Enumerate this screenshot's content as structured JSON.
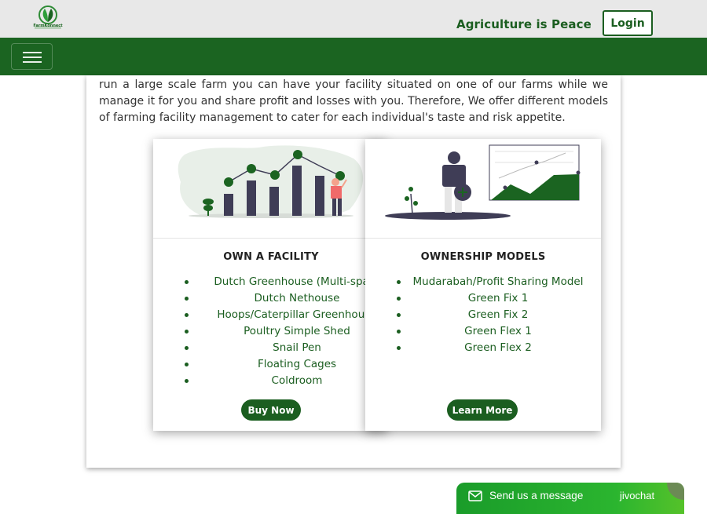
{
  "header": {
    "logo_text": "FarmKonnect",
    "tagline": "Agriculture is Peace",
    "login_label": "Login"
  },
  "intro": {
    "text": "run a large scale farm you can have your facility situated on one of our farms while we manage it for you and share profit and losses with you. Therefore, We offer different models of farming facility management to cater for each individual's taste and risk appetite."
  },
  "cards": [
    {
      "title": "OWN A FACILITY",
      "items": [
        "Dutch Greenhouse (Multi-span)",
        "Dutch Nethouse",
        "Hoops/Caterpillar Greenhouse",
        "Poultry Simple Shed",
        "Snail Pen",
        "Floating Cages",
        "Coldroom"
      ],
      "button_label": "Buy Now"
    },
    {
      "title": "OWNERSHIP MODELS",
      "items": [
        "Mudarabah/Profit Sharing Model",
        "Green Fix 1",
        "Green Fix 2",
        "Green Flex 1",
        "Green Flex 2"
      ],
      "button_label": "Learn More"
    }
  ],
  "chat": {
    "label": "Send us a message",
    "brand": "jivochat"
  },
  "colors": {
    "brand_green": "#1b5e20",
    "nav_green": "#1b6421",
    "header_bg": "#e8e8e8"
  }
}
